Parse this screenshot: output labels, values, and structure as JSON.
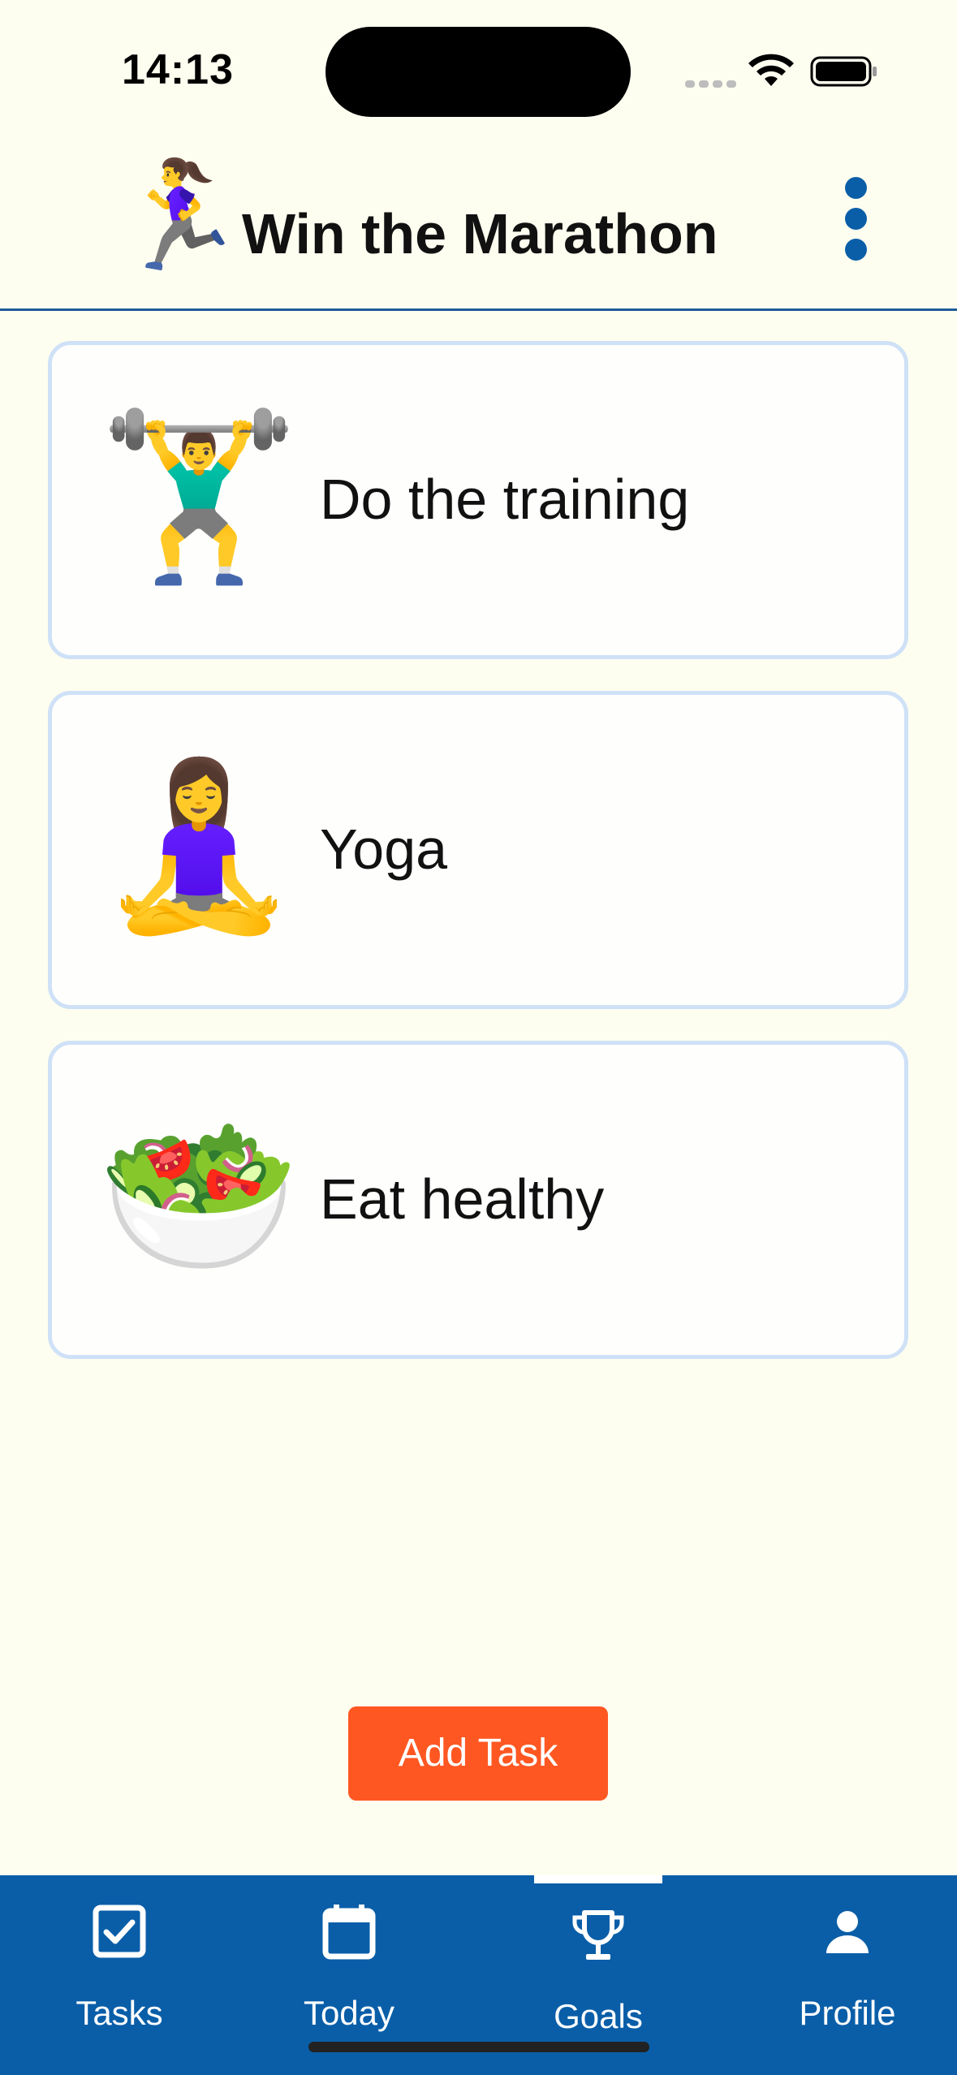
{
  "status_bar": {
    "time": "14:13"
  },
  "header": {
    "goal_emoji": "🏃‍♀️",
    "title": "Win the Marathon",
    "menu_icon": "more-vertical-icon"
  },
  "tasks": [
    {
      "emoji": "🏋️‍♂️",
      "label": "Do the training"
    },
    {
      "emoji": "🧘‍♀️",
      "label": "Yoga"
    },
    {
      "emoji": "🥗",
      "label": "Eat healthy"
    }
  ],
  "add_task": {
    "label": "Add Task",
    "color": "#FF5722"
  },
  "bottom_nav": {
    "background": "#0A5EA8",
    "active": "Goals",
    "items": [
      {
        "label": "Tasks",
        "icon": "checkbox-icon"
      },
      {
        "label": "Today",
        "icon": "calendar-icon"
      },
      {
        "label": "Goals",
        "icon": "trophy-icon"
      },
      {
        "label": "Profile",
        "icon": "person-icon"
      }
    ]
  },
  "colors": {
    "background": "#FEFEF0",
    "accent": "#0A5EA8",
    "card_border": "#CFE1F7"
  }
}
